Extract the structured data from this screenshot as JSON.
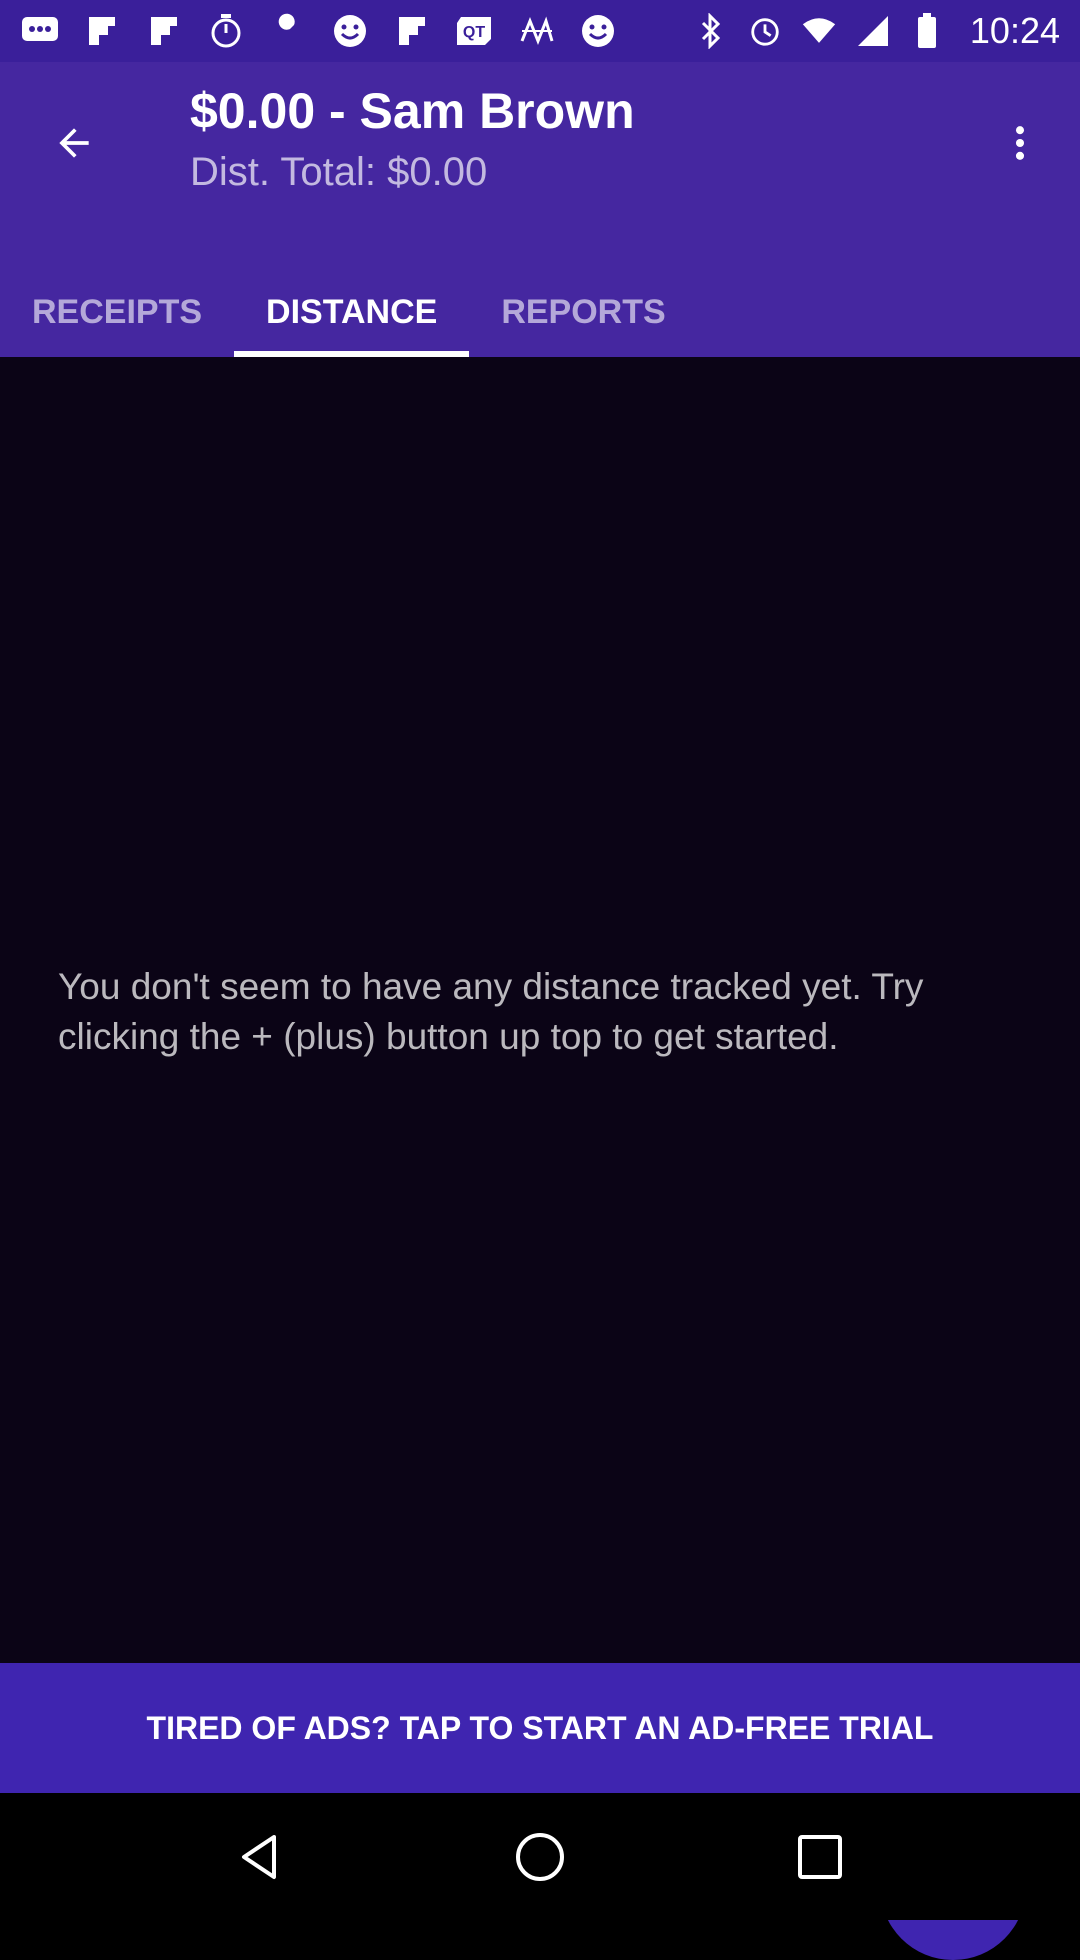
{
  "status_bar": {
    "time": "10:24",
    "icons": [
      "chat-icon",
      "flipboard-icon",
      "flipboard-icon",
      "timer-icon",
      "wrench-icon",
      "smiley-icon",
      "flipboard-icon",
      "qt-icon",
      "grid-app-icon",
      "smiley-icon"
    ],
    "right_icons": [
      "bluetooth-icon",
      "alarm-icon",
      "wifi-icon",
      "signal-icon",
      "battery-icon"
    ]
  },
  "appbar": {
    "title": "$0.00 - Sam Brown",
    "subtitle": "Dist. Total: $0.00",
    "background": "#4527a0"
  },
  "tabs": [
    {
      "label": "RECEIPTS",
      "active": false
    },
    {
      "label": "DISTANCE",
      "active": true
    },
    {
      "label": "REPORTS",
      "active": false
    }
  ],
  "main": {
    "empty_message": "You don't seem to have any distance tracked yet. Try clicking the + (plus) button up top to get started."
  },
  "fab": {
    "icon": "plus-icon",
    "color": "#3f25b0"
  },
  "ad_banner": {
    "label": "TIRED OF ADS? TAP TO START AN AD-FREE TRIAL"
  },
  "navbar": {
    "icons": [
      "back-triangle-icon",
      "home-circle-icon",
      "recents-square-icon"
    ]
  }
}
